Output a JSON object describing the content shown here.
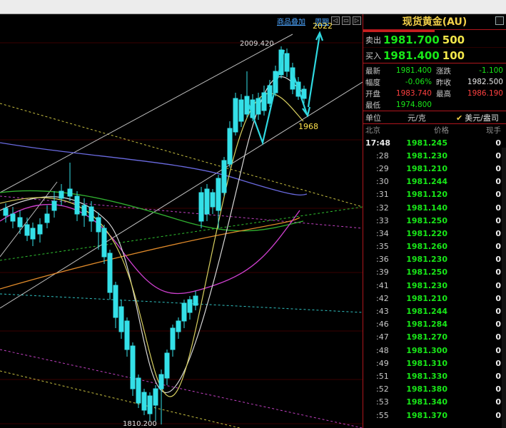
{
  "toolbar": {
    "overlay_label": "商品叠加",
    "period_label": "周期"
  },
  "chart": {
    "high_label": "2009.420",
    "low_label": "1810.200",
    "target_up": "2022",
    "target_down": "1968",
    "colors": {
      "candle_up": "#e8362f",
      "candle_down": "#34e0e8",
      "ma_white": "#d8d8d8",
      "ma_yellow": "#d8d060",
      "ma_magenta": "#d040d0",
      "ma_green": "#30b030",
      "ma_orange": "#e08a2a",
      "ma_blue": "#6a6ae0",
      "arrow": "#2fd8e0"
    }
  },
  "panel": {
    "title": "现货黄金(AU)",
    "sell": {
      "label": "卖出",
      "price": "1981.700",
      "volume": "500"
    },
    "buy": {
      "label": "买入",
      "price": "1981.400",
      "volume": "100"
    },
    "stats": [
      {
        "k": "最新",
        "v": "1981.400",
        "vc": "#18e818",
        "k2": "涨跌",
        "v2": "-1.100",
        "v2c": "#18e818"
      },
      {
        "k": "幅度",
        "v": "-0.06%",
        "vc": "#18e818",
        "k2": "昨收",
        "v2": "1982.500",
        "v2c": "#e8e8e8"
      },
      {
        "k": "开盘",
        "v": "1983.740",
        "vc": "#ff4040",
        "k2": "最高",
        "v2": "1986.190",
        "v2c": "#ff4040"
      },
      {
        "k": "最低",
        "v": "1974.800",
        "vc": "#18e818",
        "k2": "",
        "v2": "",
        "v2c": "#e8e8e8"
      }
    ],
    "unit_label": "单位",
    "unit_value": "元/克",
    "unit_alt": "美元/盎司",
    "col_time": "北京",
    "col_price": "价格",
    "col_vol": "现手",
    "ticks": [
      {
        "t": "17:48",
        "p": "1981.245",
        "q": "0"
      },
      {
        "t": ":28",
        "p": "1981.230",
        "q": "0"
      },
      {
        "t": ":29",
        "p": "1981.210",
        "q": "0"
      },
      {
        "t": ":30",
        "p": "1981.244",
        "q": "0"
      },
      {
        "t": ":31",
        "p": "1981.120",
        "q": "0"
      },
      {
        "t": ":32",
        "p": "1981.140",
        "q": "0"
      },
      {
        "t": ":33",
        "p": "1981.250",
        "q": "0"
      },
      {
        "t": ":34",
        "p": "1981.220",
        "q": "0"
      },
      {
        "t": ":35",
        "p": "1981.260",
        "q": "0"
      },
      {
        "t": ":36",
        "p": "1981.230",
        "q": "0"
      },
      {
        "t": ":39",
        "p": "1981.250",
        "q": "0"
      },
      {
        "t": ":41",
        "p": "1981.230",
        "q": "0"
      },
      {
        "t": ":42",
        "p": "1981.210",
        "q": "0"
      },
      {
        "t": ":43",
        "p": "1981.244",
        "q": "0"
      },
      {
        "t": ":46",
        "p": "1981.284",
        "q": "0"
      },
      {
        "t": ":47",
        "p": "1981.270",
        "q": "0"
      },
      {
        "t": ":48",
        "p": "1981.300",
        "q": "0"
      },
      {
        "t": ":49",
        "p": "1981.310",
        "q": "0"
      },
      {
        "t": ":51",
        "p": "1981.330",
        "q": "0"
      },
      {
        "t": ":52",
        "p": "1981.380",
        "q": "0"
      },
      {
        "t": ":53",
        "p": "1981.340",
        "q": "0"
      },
      {
        "t": ":55",
        "p": "1981.370",
        "q": "0"
      }
    ]
  }
}
